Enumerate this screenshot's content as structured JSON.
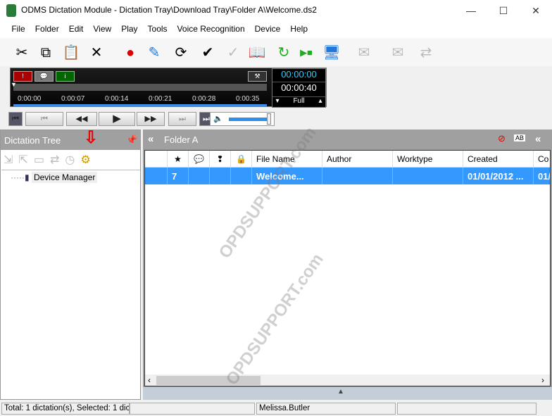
{
  "window": {
    "title": "ODMS Dictation Module - Dictation Tray\\Download Tray\\Folder A\\Welcome.ds2",
    "minimize": "—",
    "maximize": "☐",
    "close": "✕"
  },
  "menu": [
    "File",
    "Folder",
    "Edit",
    "View",
    "Play",
    "Tools",
    "Voice Recognition",
    "Device",
    "Help"
  ],
  "toolbar": [
    {
      "icon": "cut-icon",
      "g": "✂"
    },
    {
      "icon": "copy-icon",
      "g": "⧉"
    },
    {
      "icon": "paste-icon",
      "g": "📋"
    },
    {
      "icon": "delete-icon",
      "g": "✕"
    },
    {
      "icon": "record-icon",
      "g": "●"
    },
    {
      "icon": "edit-dictation-icon",
      "g": "✎"
    },
    {
      "icon": "convert-icon",
      "g": "⟳"
    },
    {
      "icon": "finish-icon",
      "g": "✔"
    },
    {
      "icon": "pending-icon",
      "g": "✓"
    },
    {
      "icon": "book-icon",
      "g": "📖"
    },
    {
      "icon": "refresh-icon",
      "g": "↻"
    },
    {
      "icon": "play-stop-icon",
      "g": "▶■"
    },
    {
      "icon": "speaker-monitor-icon",
      "g": "🖥"
    },
    {
      "icon": "email-icon",
      "g": "✉"
    },
    {
      "icon": "ftp-icon",
      "g": "✉"
    },
    {
      "icon": "sync-icon",
      "g": "⇄"
    }
  ],
  "player": {
    "ticks": [
      "0:00:00",
      "0:00:07",
      "0:00:14",
      "0:00:21",
      "0:00:28",
      "0:00:35"
    ],
    "current": "00:00:00",
    "total": "00:00:40",
    "speed": "Full",
    "progress_pct": 0,
    "volume_pct": 95
  },
  "left": {
    "title": "Dictation Tree",
    "tree": [
      {
        "label": "Device Manager"
      }
    ]
  },
  "right": {
    "title": "Folder A",
    "columns": [
      "",
      "★",
      "💬",
      "❢",
      "🔒",
      "File Name",
      "Author",
      "Worktype",
      "Created",
      "Co"
    ],
    "rows": [
      [
        "",
        "7",
        "",
        "",
        "",
        "Welcome...",
        "",
        "",
        "01/01/2012 ...",
        "01/"
      ]
    ]
  },
  "status": [
    "Total: 1 dictation(s), Selected: 1 dic",
    "",
    "Melissa.Butler",
    ""
  ],
  "watermark": "OPDSUPPORT.com",
  "colors": {
    "selection": "#3399ff",
    "panel_header": "#a0a0a0",
    "time_current": "#33ccff"
  }
}
